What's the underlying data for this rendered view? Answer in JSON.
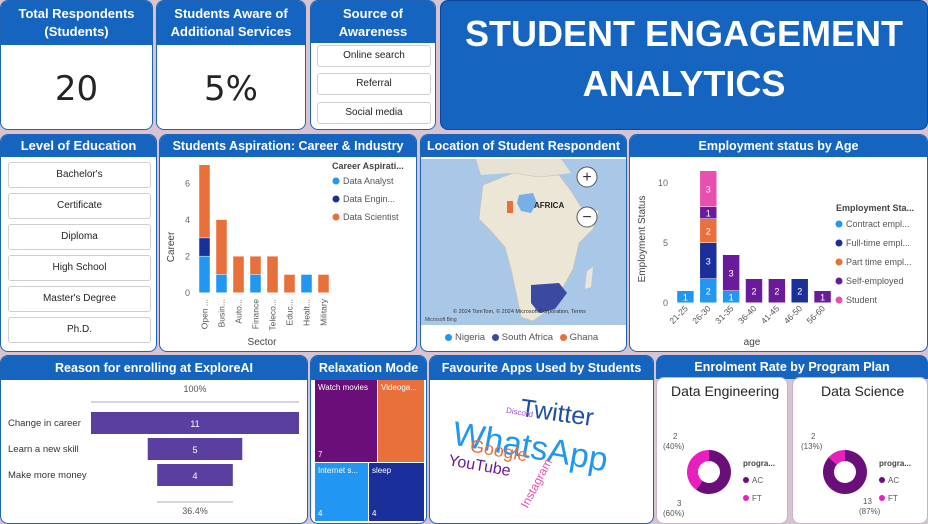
{
  "kpis": {
    "total_title": "Total Respondents (Students)",
    "total_value": "20",
    "aware_title": "Students Aware of Additional Services",
    "aware_value": "5%"
  },
  "source": {
    "title": "Source of Awareness",
    "items": [
      "Online search",
      "Referral",
      "Social media"
    ]
  },
  "banner": {
    "line1": "STUDENT ENGAGEMENT",
    "line2": "ANALYTICS",
    "color": "#1565c0"
  },
  "education": {
    "title": "Level of Education",
    "items": [
      "Bachelor's",
      "Certificate",
      "Diploma",
      "High School",
      "Master's Degree",
      "Ph.D."
    ]
  },
  "aspiration": {
    "title": "Students Aspiration: Career & Industry",
    "xlabel": "Sector",
    "ylabel": "Career",
    "legend_title": "Career Aspirati...",
    "legend": [
      "Data Analyst",
      "Data Engin...",
      "Data Scientist"
    ]
  },
  "location": {
    "title": "Location of Student Respondent",
    "map_label": "AFRICA",
    "attribution": "© 2024 TomTom, © 2024 Microsoft Corporation, Terms",
    "brand": "Microsoft Bing",
    "legend": [
      "Nigeria",
      "South Africa",
      "Ghana"
    ],
    "colors": {
      "Nigeria": "#2196f3",
      "South Africa": "#3b4aa0",
      "Ghana": "#e8703a"
    }
  },
  "employment": {
    "title": "Employment status by Age",
    "xlabel": "age",
    "ylabel": "Employment Status",
    "legend_title": "Employment Sta...",
    "legend": [
      "Contract empl...",
      "Full-time empl...",
      "Part time empl...",
      "Self-employed",
      "Student"
    ]
  },
  "reason": {
    "title": "Reason for enrolling at ExploreAI",
    "top_pct": "100%",
    "bottom_pct": "36.4%"
  },
  "relaxation": {
    "title": "Relaxation Mode",
    "tiles": [
      {
        "label": "Watch movies",
        "value": "7"
      },
      {
        "label": "Videoga...",
        "value": ""
      },
      {
        "label": "Internet s...",
        "value": "4"
      },
      {
        "label": "sleep",
        "value": "4"
      }
    ]
  },
  "apps": {
    "title": "Favourite Apps Used by Students",
    "words": [
      "Twitter",
      "WhatsApp",
      "Google",
      "YouTube",
      "Instagram",
      "Discord"
    ]
  },
  "enrolment": {
    "title": "Enrolment Rate by Program Plan",
    "legend_title": "progra...",
    "legend": [
      "AC",
      "FT"
    ],
    "charts": [
      {
        "title": "Data Engineering",
        "ac_label": "3",
        "ac_pct": "(60%)",
        "ft_label": "2",
        "ft_pct": "(40%)"
      },
      {
        "title": "Data Science",
        "ac_label": "13",
        "ac_pct": "(87%)",
        "ft_label": "2",
        "ft_pct": "(13%)"
      }
    ]
  },
  "chart_data": [
    {
      "type": "bar",
      "title": "Students Aspiration: Career & Industry",
      "xlabel": "Sector",
      "ylabel": "Career",
      "categories": [
        "Open ...",
        "Busin...",
        "Auto...",
        "Finance",
        "Teleco...",
        "Educ...",
        "Healt...",
        "Military"
      ],
      "series": [
        {
          "name": "Data Analyst",
          "color": "#2196f3",
          "values": [
            2,
            1,
            0,
            1,
            0,
            0,
            1,
            0
          ]
        },
        {
          "name": "Data Engin...",
          "color": "#1a2f9a",
          "values": [
            1,
            0,
            0,
            0,
            0,
            0,
            0,
            0
          ]
        },
        {
          "name": "Data Scientist",
          "color": "#e8703a",
          "values": [
            4,
            3,
            2,
            1,
            2,
            1,
            0,
            1
          ]
        }
      ],
      "yticks": [
        0,
        2,
        4,
        6
      ],
      "ylim": [
        0,
        7
      ]
    },
    {
      "type": "bar",
      "title": "Employment status by Age",
      "xlabel": "age",
      "ylabel": "Employment Status",
      "categories": [
        "21-25",
        "26-30",
        "31-35",
        "36-40",
        "41-45",
        "46-50",
        "56-60"
      ],
      "series": [
        {
          "name": "Contract empl...",
          "color": "#2196f3",
          "values": [
            1,
            2,
            1,
            0,
            0,
            0,
            0
          ]
        },
        {
          "name": "Full-time empl...",
          "color": "#1a2f9a",
          "values": [
            0,
            3,
            0,
            0,
            0,
            2,
            0
          ]
        },
        {
          "name": "Part time empl...",
          "color": "#e8703a",
          "values": [
            0,
            2,
            0,
            0,
            0,
            0,
            0
          ]
        },
        {
          "name": "Self-employed",
          "color": "#6a1b9a",
          "values": [
            0,
            1,
            3,
            2,
            2,
            0,
            1
          ]
        },
        {
          "name": "Student",
          "color": "#e84fae",
          "values": [
            0,
            3,
            0,
            0,
            0,
            0,
            0
          ]
        }
      ],
      "yticks": [
        0,
        5,
        10
      ],
      "ylim": [
        0,
        11
      ]
    },
    {
      "type": "bar",
      "title": "Reason for enrolling at ExploreAI",
      "categories": [
        "Change in career",
        "Learn a new skill",
        "Make more money"
      ],
      "values": [
        11,
        5,
        4
      ],
      "color": "#5b3fa0"
    },
    {
      "type": "pie",
      "title": "Data Engineering",
      "categories": [
        "AC",
        "FT"
      ],
      "values": [
        3,
        2
      ],
      "colors": [
        "#6a0f7a",
        "#e91ebf"
      ]
    },
    {
      "type": "pie",
      "title": "Data Science",
      "categories": [
        "AC",
        "FT"
      ],
      "values": [
        13,
        2
      ],
      "colors": [
        "#6a0f7a",
        "#e91ebf"
      ]
    }
  ]
}
